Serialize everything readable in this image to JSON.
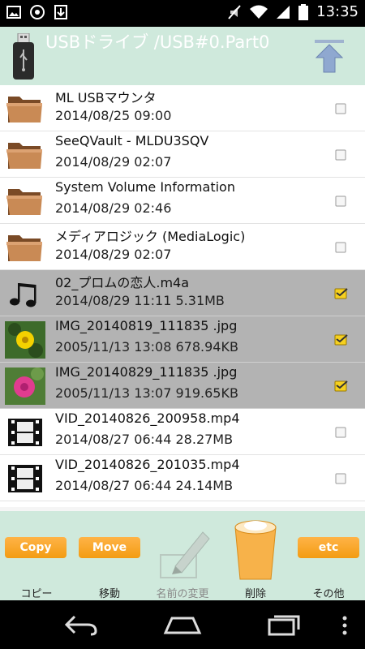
{
  "status_bar": {
    "time": "13:35"
  },
  "header": {
    "title": "USBドライブ /USB#0.Part0"
  },
  "files": [
    {
      "name": "ML USBマウンタ",
      "meta": "2014/08/25 09:00",
      "type": "folder",
      "selected": false
    },
    {
      "name": "SeeQVault - MLDU3SQV",
      "meta": "2014/08/29 02:07",
      "type": "folder",
      "selected": false
    },
    {
      "name": "System Volume Information",
      "meta": "2014/08/29 02:46",
      "type": "folder",
      "selected": false
    },
    {
      "name": "メディアロジック (MediaLogic)",
      "meta": "2014/08/29 02:07",
      "type": "folder",
      "selected": false
    },
    {
      "name": "02_プロムの恋人.m4a",
      "meta": "2014/08/29 11:11 5.31MB",
      "type": "audio",
      "selected": true
    },
    {
      "name": "IMG_20140819_111835 .jpg",
      "meta": "2005/11/13 13:08 678.94KB",
      "type": "image-yellow",
      "selected": true
    },
    {
      "name": "IMG_20140829_111835 .jpg",
      "meta": "2005/11/13 13:07 919.65KB",
      "type": "image-pink",
      "selected": true
    },
    {
      "name": "VID_20140826_200958.mp4",
      "meta": "2014/08/27 06:44 28.27MB",
      "type": "video",
      "selected": false
    },
    {
      "name": "VID_20140826_201035.mp4",
      "meta": "2014/08/27 06:44 24.14MB",
      "type": "video",
      "selected": false
    }
  ],
  "toolbar": {
    "copy_button": "Copy",
    "copy_label": "コピー",
    "move_button": "Move",
    "move_label": "移動",
    "rename_label": "名前の変更",
    "delete_label": "削除",
    "etc_button": "etc",
    "etc_label": "その他"
  },
  "colors": {
    "header_bg": "#cfe9dc",
    "selected_row": "#b3b3b3",
    "button_orange": "#f39c12"
  }
}
